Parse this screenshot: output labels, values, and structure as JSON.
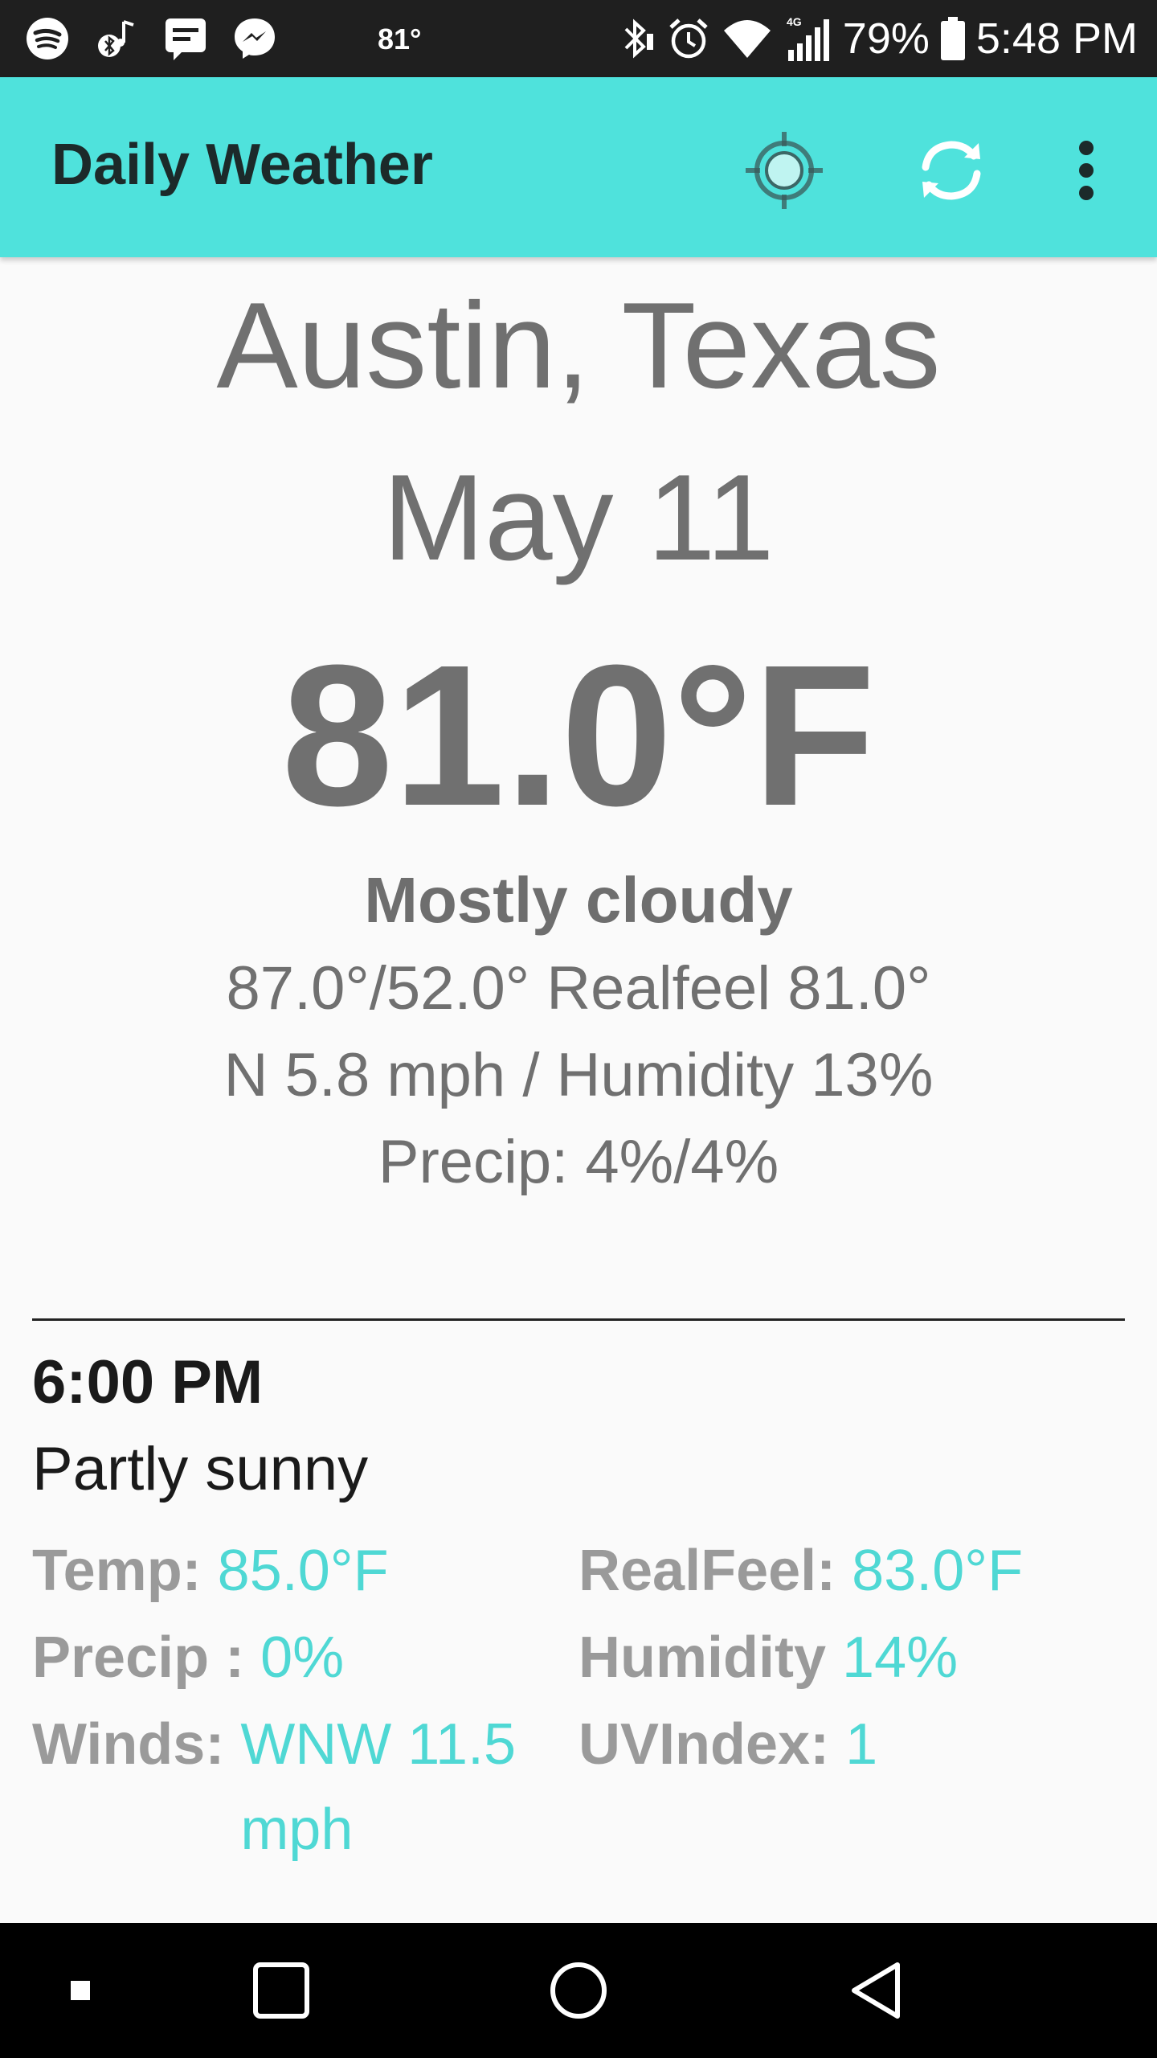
{
  "status_bar": {
    "temperature": "81°",
    "battery_percent": "79%",
    "time": "5:48 PM",
    "network": "4G",
    "icons_left": [
      "spotify-icon",
      "bluetooth-music-icon",
      "message-icon",
      "messenger-icon"
    ],
    "icons_right": [
      "bluetooth-icon",
      "alarm-icon",
      "wifi-icon",
      "signal-icon",
      "battery-icon"
    ]
  },
  "app_bar": {
    "title": "Daily Weather",
    "accent_color": "#4fe2dc",
    "actions": [
      "locate-icon",
      "refresh-icon",
      "overflow-menu-icon"
    ]
  },
  "current": {
    "city": "Austin, Texas",
    "date": "May 11",
    "temperature": "81.0°F",
    "condition": "Mostly cloudy",
    "hi_lo_realfeel": "87.0°/52.0° Realfeel 81.0°",
    "wind_humidity": "N 5.8 mph / Humidity 13%",
    "precip": "Precip: 4%/4%"
  },
  "hourly": {
    "time": "6:00 PM",
    "condition": "Partly sunny",
    "temp_label": "Temp:",
    "temp_value": "85.0°F",
    "realfeel_label": "RealFeel:",
    "realfeel_value": "83.0°F",
    "precip_label": "Precip :",
    "precip_value": "0%",
    "humidity_label": "Humidity",
    "humidity_value": "14%",
    "winds_label": "Winds:",
    "winds_value": "WNW 11.5 mph",
    "uv_label": "UVIndex:",
    "uv_value": "1",
    "value_color": "#4fd8d4"
  },
  "nav_bar": {
    "buttons": [
      "dot-icon",
      "recents-icon",
      "home-icon",
      "back-icon"
    ]
  }
}
